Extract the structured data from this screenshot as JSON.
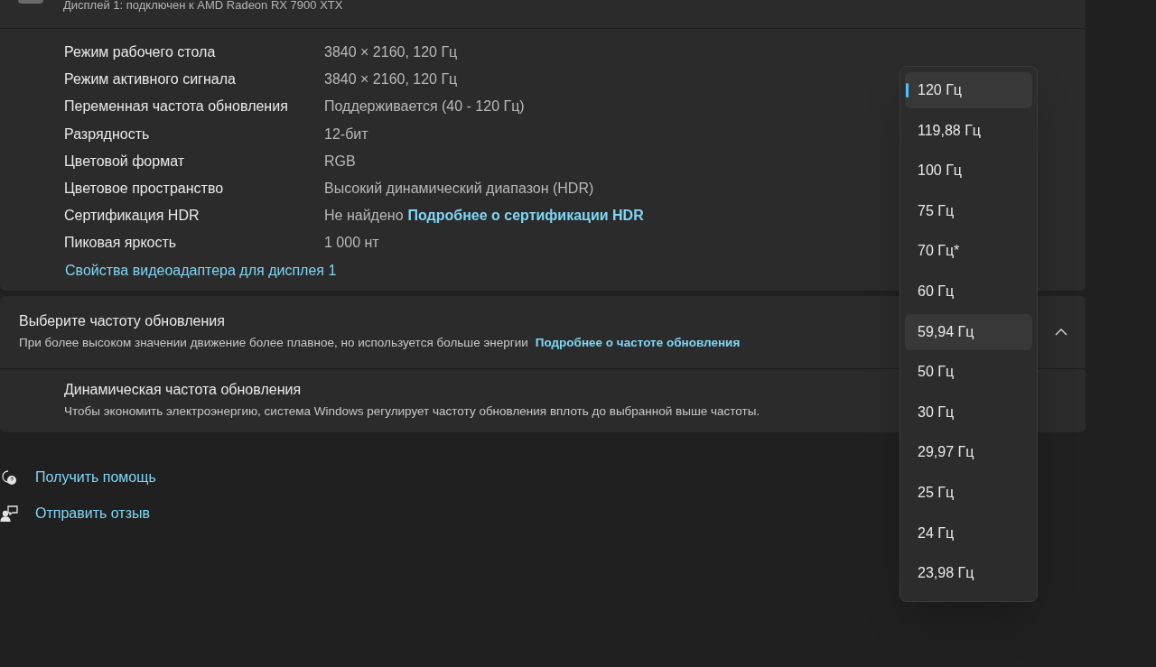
{
  "display_header": {
    "subtitle": "Дисплей 1: подключен к AMD Radeon RX 7900 XTX"
  },
  "details": [
    {
      "label": "Режим рабочего стола",
      "value": "3840 × 2160, 120 Гц"
    },
    {
      "label": "Режим активного сигнала",
      "value": "3840 × 2160, 120 Гц"
    },
    {
      "label": "Переменная частота обновления",
      "value": "Поддерживается (40 - 120 Гц)"
    },
    {
      "label": "Разрядность",
      "value": "12-бит"
    },
    {
      "label": "Цветовой формат",
      "value": "RGB"
    },
    {
      "label": "Цветовое пространство",
      "value": "Высокий динамический диапазон (HDR)"
    },
    {
      "label": "Сертификация HDR",
      "value": "Не найдено",
      "link": "Подробнее о сертификации HDR"
    },
    {
      "label": "Пиковая яркость",
      "value": "1 000 нт"
    }
  ],
  "adapter_link": "Свойства видеоадаптера для дисплея 1",
  "refresh_rate": {
    "title": "Выберите частоту обновления",
    "description": "При более высоком значении движение более плавное, но используется больше энергии",
    "link": "Подробнее о частоте обновления",
    "expanded": true
  },
  "dynamic_refresh": {
    "title": "Динамическая частота обновления",
    "description": "Чтобы экономить электроэнергию, система Windows регулирует частоту обновления вплоть до выбранной выше частоты."
  },
  "footer_links": [
    {
      "kind": "help",
      "label": "Получить помощь"
    },
    {
      "kind": "feedback",
      "label": "Отправить отзыв"
    }
  ],
  "dropdown_options": [
    {
      "label": "120 Гц",
      "selected": true,
      "hovered": false
    },
    {
      "label": "119,88 Гц",
      "selected": false,
      "hovered": false
    },
    {
      "label": "100 Гц",
      "selected": false,
      "hovered": false
    },
    {
      "label": "75 Гц",
      "selected": false,
      "hovered": false
    },
    {
      "label": "70 Гц*",
      "selected": false,
      "hovered": false
    },
    {
      "label": "60 Гц",
      "selected": false,
      "hovered": false
    },
    {
      "label": "59,94 Гц",
      "selected": false,
      "hovered": true
    },
    {
      "label": "50 Гц",
      "selected": false,
      "hovered": false
    },
    {
      "label": "30 Гц",
      "selected": false,
      "hovered": false
    },
    {
      "label": "29,97 Гц",
      "selected": false,
      "hovered": false
    },
    {
      "label": "25 Гц",
      "selected": false,
      "hovered": false
    },
    {
      "label": "24 Гц",
      "selected": false,
      "hovered": false
    },
    {
      "label": "23,98 Гц",
      "selected": false,
      "hovered": false
    }
  ]
}
